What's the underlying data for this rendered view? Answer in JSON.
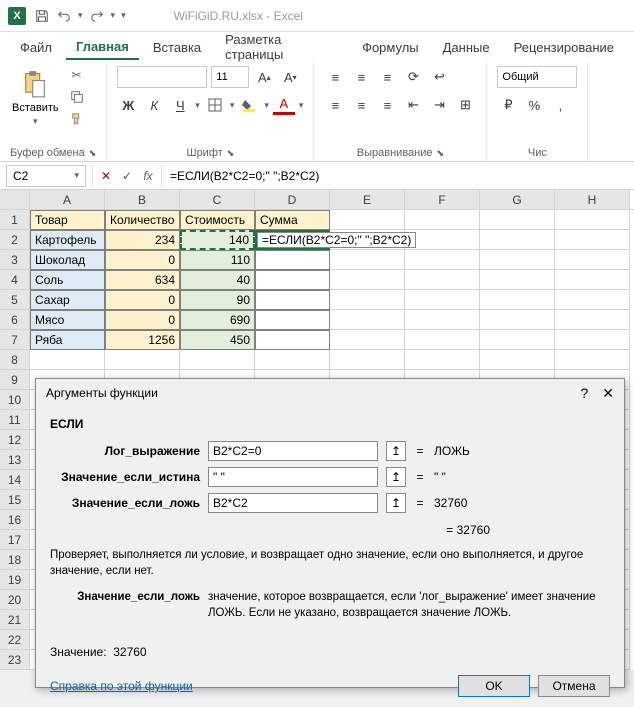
{
  "titlebar": {
    "filename": "WiFiGiD.RU.xlsx",
    "app": "Excel"
  },
  "tabs": {
    "file": "Файл",
    "home": "Главная",
    "insert": "Вставка",
    "layout": "Разметка страницы",
    "formulas": "Формулы",
    "data": "Данные",
    "review": "Рецензирование"
  },
  "ribbon": {
    "clipboard": {
      "paste": "Вставить",
      "label": "Буфер обмена"
    },
    "font": {
      "label": "Шрифт",
      "size": "11"
    },
    "alignment": {
      "label": "Выравнивание"
    },
    "number": {
      "label": "Чис",
      "format": "Общий"
    }
  },
  "formulabar": {
    "namebox": "C2",
    "formula": "=ЕСЛИ(B2*C2=0;\" \";B2*C2)"
  },
  "cols": [
    "A",
    "B",
    "C",
    "D",
    "E",
    "F",
    "G",
    "H"
  ],
  "headers": {
    "a": "Товар",
    "b": "Количество",
    "c": "Стоимость",
    "d": "Сумма"
  },
  "rows": [
    {
      "a": "Картофель",
      "b": "234",
      "c": "140",
      "d": "=ЕСЛИ(B2*C2=0;\" \";B2*C2)"
    },
    {
      "a": "Шоколад",
      "b": "0",
      "c": "110",
      "d": ""
    },
    {
      "a": "Соль",
      "b": "634",
      "c": "40",
      "d": ""
    },
    {
      "a": "Сахар",
      "b": "0",
      "c": "90",
      "d": ""
    },
    {
      "a": "Мясо",
      "b": "0",
      "c": "690",
      "d": ""
    },
    {
      "a": "Ряба",
      "b": "1256",
      "c": "450",
      "d": ""
    }
  ],
  "dialog": {
    "title": "Аргументы функции",
    "fn": "ЕСЛИ",
    "args": {
      "logical": {
        "label": "Лог_выражение",
        "value": "B2*C2=0",
        "result": "ЛОЖЬ"
      },
      "iftrue": {
        "label": "Значение_если_истина",
        "value": "\" \"",
        "result": "\" \""
      },
      "iffalse": {
        "label": "Значение_если_ложь",
        "value": "B2*C2",
        "result": "32760"
      }
    },
    "preview": "= 32760",
    "desc": "Проверяет, выполняется ли условие, и возвращает одно значение, если оно выполняется, и другое значение, если нет.",
    "argdesc_label": "Значение_если_ложь",
    "argdesc_text": "значение, которое возвращается, если 'лог_выражение' имеет значение ЛОЖЬ. Если не указано, возвращается значение ЛОЖЬ.",
    "result_label": "Значение:",
    "result_value": "32760",
    "help": "Справка по этой функции",
    "ok": "OK",
    "cancel": "Отмена"
  }
}
